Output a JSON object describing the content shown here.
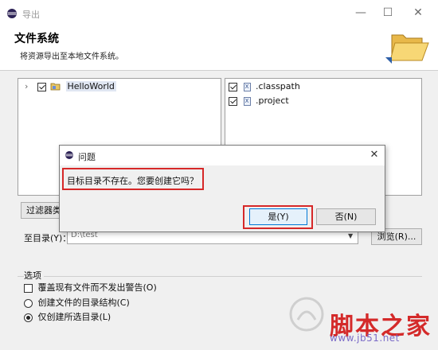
{
  "window": {
    "title": "导出"
  },
  "header": {
    "title": "文件系统",
    "description": "将资源导出至本地文件系统。"
  },
  "left_tree": {
    "items": [
      {
        "label": "HelloWorld",
        "checked": true,
        "expanded": false
      }
    ]
  },
  "right_tree": {
    "items": [
      {
        "label": ".classpath",
        "checked": true
      },
      {
        "label": ".project",
        "checked": true
      }
    ]
  },
  "filter_button": {
    "label": "过滤器类型"
  },
  "destination": {
    "label": "至目录(Y)：",
    "value": "D:\\test",
    "browse_label": "浏览(R)..."
  },
  "options": {
    "title": "选项",
    "overwrite": {
      "label": "覆盖现有文件而不发出警告(O)",
      "checked": false
    },
    "create_structure": {
      "label": "创建文件的目录结构(C)",
      "selected": false
    },
    "create_selected": {
      "label": "仅创建所选目录(L)",
      "selected": true
    }
  },
  "dialog": {
    "title": "问题",
    "message": "目标目录不存在。您要创建它吗？",
    "yes_label": "是(Y)",
    "no_label": "否(N)"
  },
  "watermark": {
    "text": "脚本之家",
    "url": "www.jb51.net"
  },
  "colors": {
    "highlight_red": "#d62828",
    "accent_blue": "#0078d7",
    "watermark_red": "#d42a2a"
  }
}
